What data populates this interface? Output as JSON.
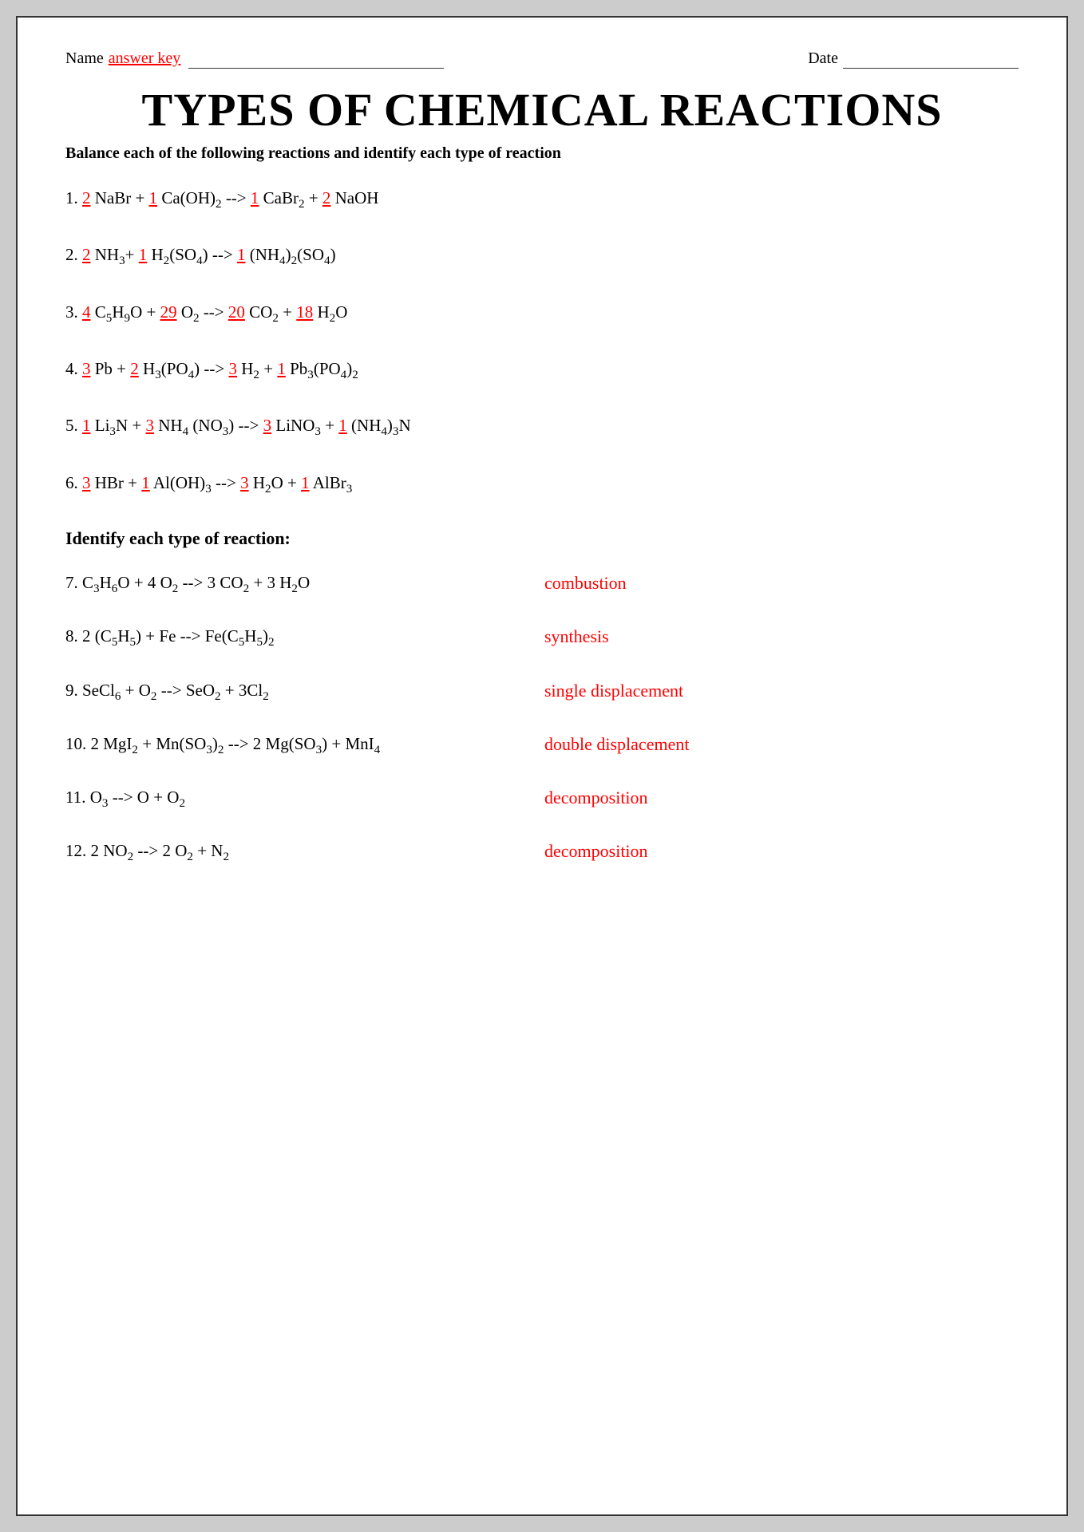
{
  "header": {
    "name_label": "Name",
    "answer_key": "answer key",
    "date_label": "Date"
  },
  "title": "TYPES OF CHEMICAL REACTIONS",
  "subtitle": "Balance each of the following reactions and identify each type of reaction",
  "balance_problems": [
    {
      "number": "1.",
      "html": "1_nabr_equation"
    },
    {
      "number": "2.",
      "html": "2_nh3_equation"
    },
    {
      "number": "3.",
      "html": "3_c5h9o_equation"
    },
    {
      "number": "4.",
      "html": "4_pb_equation"
    },
    {
      "number": "5.",
      "html": "5_li3n_equation"
    },
    {
      "number": "6.",
      "html": "6_hbr_equation"
    }
  ],
  "identify_section_title": "Identify each type of reaction:",
  "identify_problems": [
    {
      "number": "7.",
      "equation": "C₃H₆O + 4 O₂ --> 3 CO₂ + 3 H₂O",
      "answer": "combustion"
    },
    {
      "number": "8.",
      "equation": "2 (C₅H₅) + Fe --> Fe(C₅H₅)₂",
      "answer": "synthesis"
    },
    {
      "number": "9.",
      "equation": "SeCl₆ + O₂ --> SeO₂ + 3Cl₂",
      "answer": "single displacement"
    },
    {
      "number": "10.",
      "equation": "2 MgI₂ + Mn(SO₃)₂ --> 2 Mg(SO₃) + MnI₄",
      "answer": "double displacement"
    },
    {
      "number": "11.",
      "equation": "O₃ --> O + O₂",
      "answer": "decomposition"
    },
    {
      "number": "12.",
      "equation": "2 NO₂ --> 2 O₂ + N₂",
      "answer": "decomposition"
    }
  ],
  "answers": {
    "p1": [
      "2",
      "1",
      "1",
      "2"
    ],
    "p2": [
      "2",
      "1",
      "1"
    ],
    "p3": [
      "4",
      "29",
      "20",
      "18"
    ],
    "p4": [
      "3",
      "2",
      "3",
      "1"
    ],
    "p5": [
      "1",
      "3",
      "3",
      "1"
    ],
    "p6": [
      "3",
      "1",
      "3",
      "1"
    ]
  }
}
